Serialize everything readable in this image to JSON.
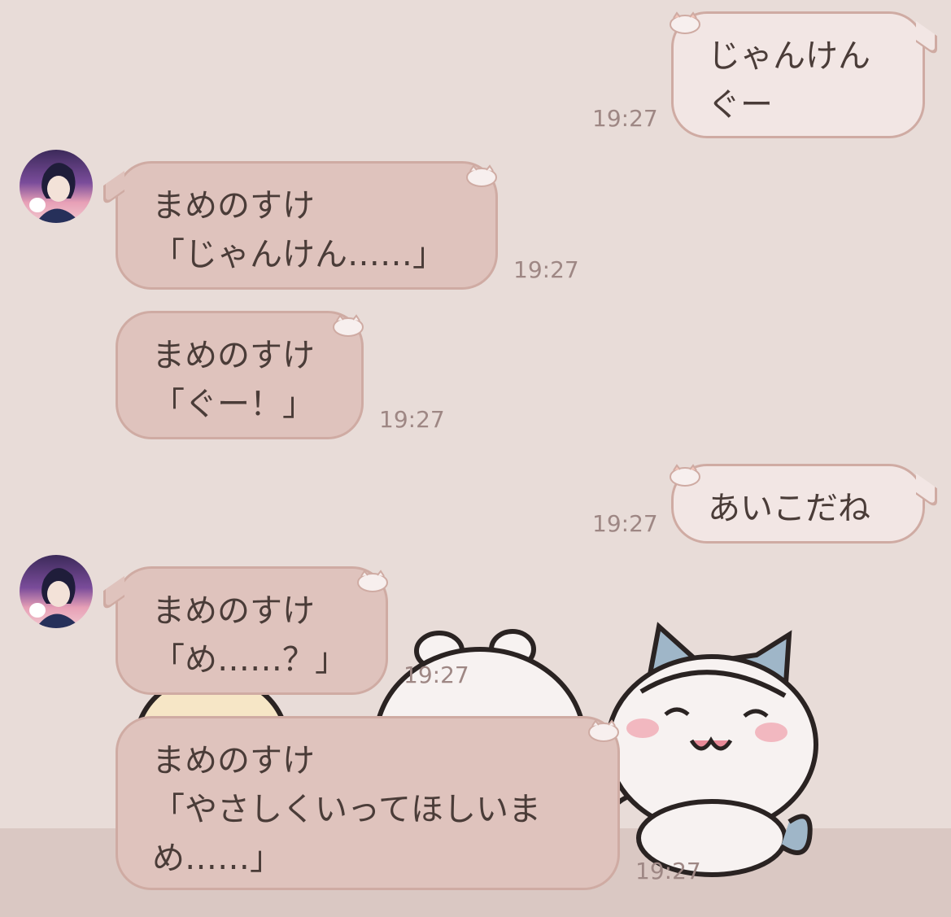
{
  "messages": [
    {
      "direction": "outgoing",
      "lines": [
        "じゃんけん",
        "ぐー"
      ],
      "time": "19:27"
    },
    {
      "direction": "incoming",
      "lines": [
        "まめのすけ",
        "「じゃんけん……」"
      ],
      "time": "19:27"
    },
    {
      "direction": "incoming",
      "lines": [
        "まめのすけ",
        "「ぐー！」"
      ],
      "time": "19:27"
    },
    {
      "direction": "outgoing",
      "lines": [
        "あいこだね"
      ],
      "time": "19:27"
    },
    {
      "direction": "incoming",
      "lines": [
        "まめのすけ",
        "「め……？」"
      ],
      "time": "19:27"
    },
    {
      "direction": "incoming",
      "lines": [
        "まめのすけ",
        "「やさしくいってほしいま",
        "め……」"
      ],
      "time": "19:27"
    }
  ],
  "icons": {
    "avatar": "character-avatar-icon",
    "bubble_deco": "hamster-face-icon",
    "sticker": "cartoon-characters-sticker"
  },
  "colors": {
    "background": "#e8dcd8",
    "outgoing_bubble": "#f2e6e4",
    "incoming_bubble": "#dfc3bd",
    "bubble_border": "#cfaba3",
    "time_text": "#9e8784"
  }
}
